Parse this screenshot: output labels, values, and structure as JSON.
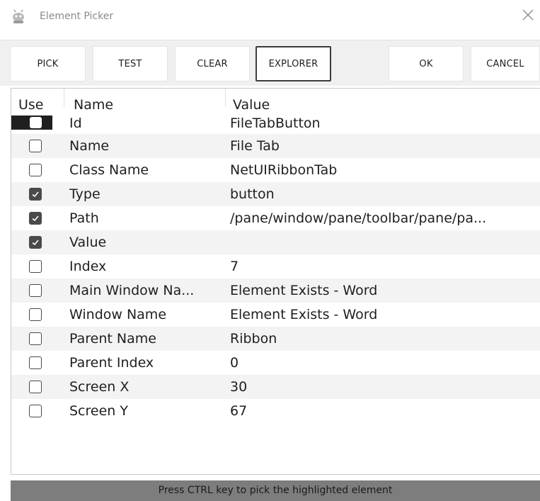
{
  "window": {
    "title": "Element Picker",
    "app_icon": "robot-icon",
    "close_icon": "close-icon"
  },
  "toolbar": {
    "pick_label": "PICK",
    "test_label": "TEST",
    "clear_label": "CLEAR",
    "explorer_label": "EXPLORER",
    "ok_label": "OK",
    "cancel_label": "CANCEL"
  },
  "grid": {
    "headers": {
      "use": "Use",
      "name": "Name",
      "value": "Value"
    },
    "rows": [
      {
        "checked": false,
        "name": "Id",
        "value": "FileTabButton"
      },
      {
        "checked": false,
        "name": "Name",
        "value": "File Tab"
      },
      {
        "checked": false,
        "name": "Class Name",
        "value": "NetUIRibbonTab"
      },
      {
        "checked": true,
        "name": "Type",
        "value": "button"
      },
      {
        "checked": true,
        "name": "Path",
        "value": "/pane/window/pane/toolbar/pane/pa..."
      },
      {
        "checked": true,
        "name": "Value",
        "value": ""
      },
      {
        "checked": false,
        "name": "Index",
        "value": "7"
      },
      {
        "checked": false,
        "name": "Main Window Na...",
        "value": "Element Exists - Word"
      },
      {
        "checked": false,
        "name": "Window Name",
        "value": "Element Exists - Word"
      },
      {
        "checked": false,
        "name": "Parent Name",
        "value": "Ribbon"
      },
      {
        "checked": false,
        "name": "Parent Index",
        "value": "0"
      },
      {
        "checked": false,
        "name": "Screen X",
        "value": "30"
      },
      {
        "checked": false,
        "name": "Screen Y",
        "value": "67"
      }
    ]
  },
  "status": {
    "text": "Press CTRL key to pick the highlighted element"
  }
}
